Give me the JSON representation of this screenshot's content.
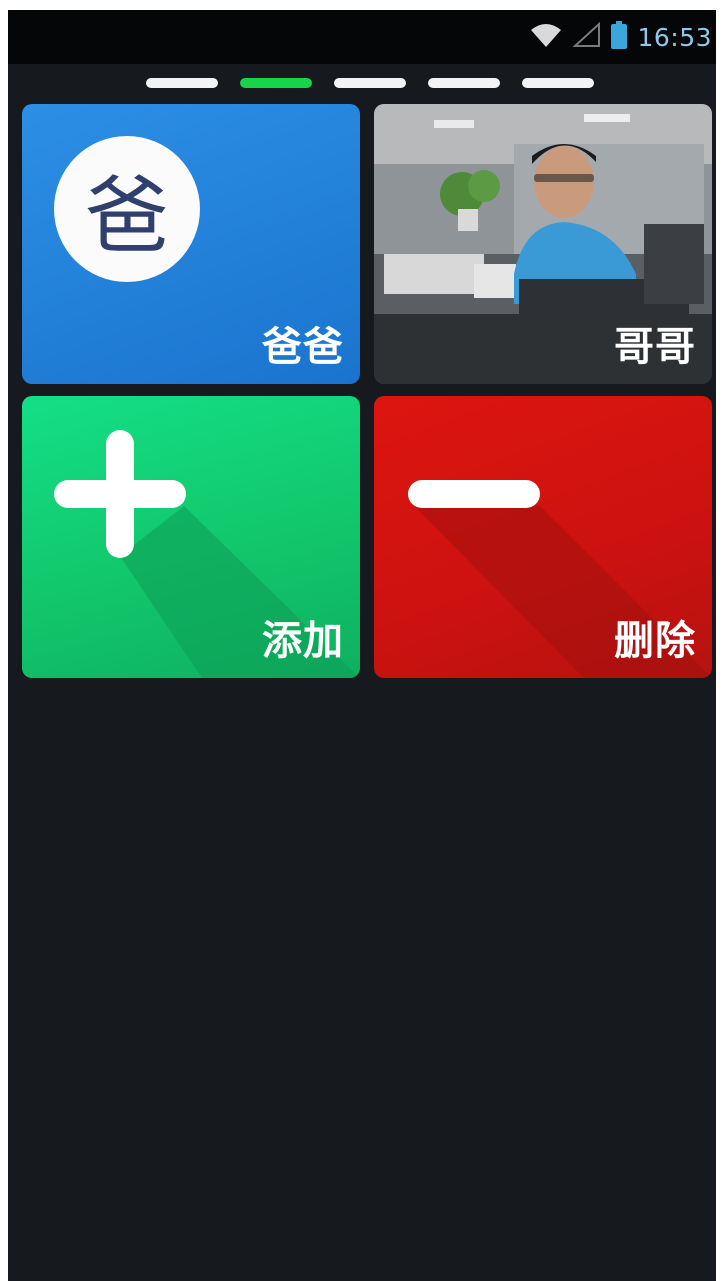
{
  "status_bar": {
    "time": "16:53",
    "icons": [
      "wifi-icon",
      "signal-icon",
      "battery-icon"
    ]
  },
  "page_indicator": {
    "count": 5,
    "active_index": 1
  },
  "tiles": [
    {
      "label": "爸爸",
      "avatar_text": "爸",
      "icon": "avatar-icon",
      "color": "#1f7fd8"
    },
    {
      "label": "哥哥",
      "icon": "photo-avatar",
      "color": "#6d7176"
    },
    {
      "label": "添加",
      "icon": "plus-icon",
      "color": "#12c76c"
    },
    {
      "label": "删除",
      "icon": "minus-icon",
      "color": "#cc1210"
    }
  ],
  "colors": {
    "background": "#16191e",
    "status_bar": "#050607",
    "indicator_active": "#17d44b",
    "indicator_inactive": "#f3f3f3",
    "time_text": "#8ec9ea"
  }
}
